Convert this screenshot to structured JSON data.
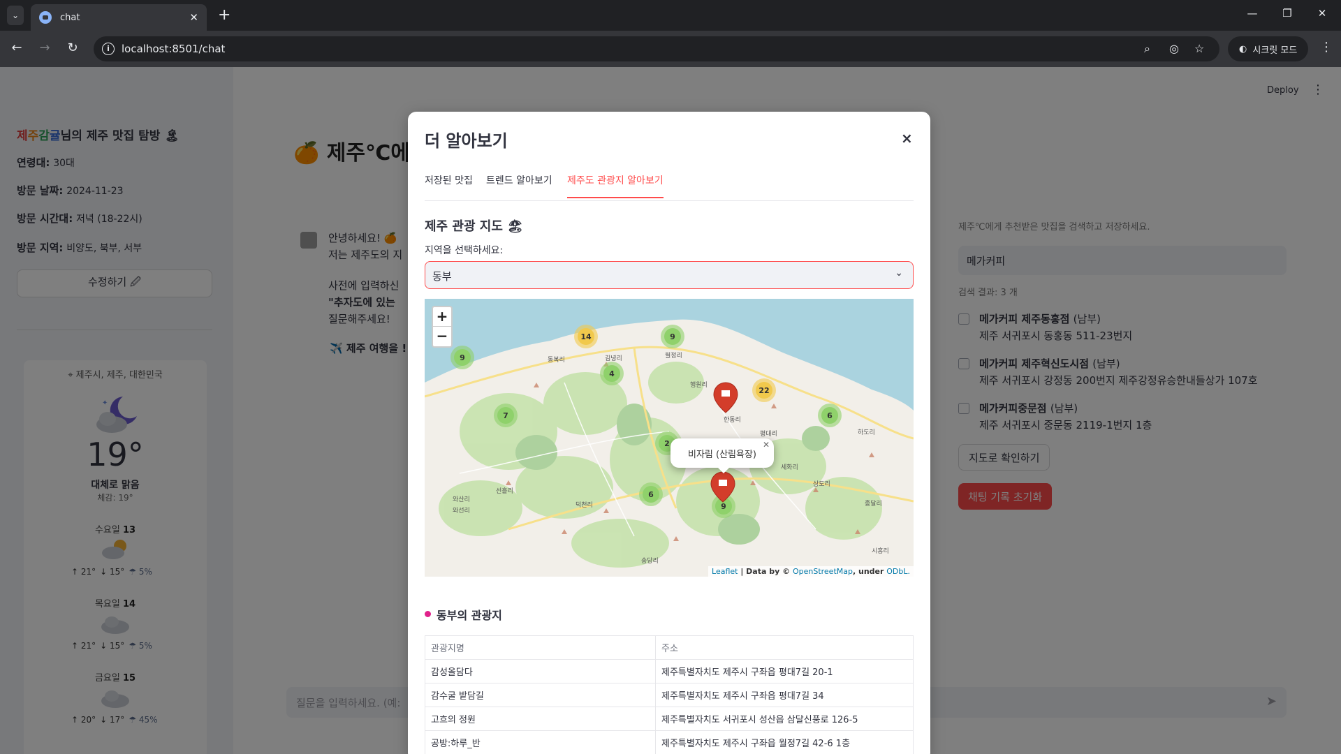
{
  "browser": {
    "tab_title": "chat",
    "url": "localhost:8501/chat",
    "incognito_label": "시크릿 모드"
  },
  "sidebar": {
    "title_parts": [
      "제",
      "주",
      "감",
      "귤",
      "님의 제주 맛집 탐방 🏝"
    ],
    "info": [
      {
        "label": "연령대:",
        "value": "30대"
      },
      {
        "label": "방문 날짜:",
        "value": "2024-11-23"
      },
      {
        "label": "방문 시간대:",
        "value": "저녁 (18-22시)"
      },
      {
        "label": "방문 지역:",
        "value": "비양도, 북부, 서부"
      }
    ],
    "edit_button": "수정하기 🖉"
  },
  "weather": {
    "location": "제주시, 제주, 대한민국",
    "temp": "19°",
    "condition": "대체로 맑음",
    "feels_like": "체감: 19°",
    "days": [
      {
        "name": "수요일",
        "date": "13",
        "high": "↑ 21°",
        "low": "↓ 15°",
        "rain": "5%"
      },
      {
        "name": "목요일",
        "date": "14",
        "high": "↑ 21°",
        "low": "↓ 15°",
        "rain": "5%"
      },
      {
        "name": "금요일",
        "date": "15",
        "high": "↑ 20°",
        "low": "↓ 17°",
        "rain": "45%"
      }
    ]
  },
  "main": {
    "title": "🍊 제주℃에게",
    "chat_lines": [
      "안녕하세요! 🍊",
      "저는 제주도의 지",
      "사전에 입력하신",
      "\"추자도에 있는",
      "질문해주세요!",
      "✈️ 제주 여행을 !"
    ],
    "input_placeholder": "질문을 입력하세요. (예:",
    "deploy": "Deploy"
  },
  "right_panel": {
    "note": "제주℃에게 추천받은 맛집을 검색하고 저장하세요.",
    "search_value": "메가커피",
    "result_count": "검색 결과: 3 개",
    "results": [
      {
        "name": "메가커피 제주동홍점",
        "region": "(남부)",
        "address": "제주 서귀포시 동홍동 511-23번지"
      },
      {
        "name": "메가커피 제주혁신도시점",
        "region": "(남부)",
        "address": "제주 서귀포시 강정동 200번지 제주강정유승한내들상가 107호"
      },
      {
        "name": "메가커피중문점",
        "region": "(남부)",
        "address": "제주 서귀포시 중문동 2119-1번지 1층"
      }
    ],
    "map_button": "지도로 확인하기",
    "reset_button": "채팅 기록 초기화"
  },
  "modal": {
    "title": "더 알아보기",
    "close": "×",
    "tabs": [
      "저장된 맛집",
      "트렌드 알아보기",
      "제주도 관광지 알아보기"
    ],
    "active_tab": 2,
    "section_title": "제주 관광 지도 🏖",
    "select_label": "지역을 선택하세요:",
    "select_value": "동부",
    "map": {
      "zoom_in": "+",
      "zoom_out": "−",
      "popup": "비자림 (산림욕장)",
      "attribution_prefix": "Leaflet",
      "attribution_mid": " | Data by © ",
      "attribution_osm": "OpenStreetMap",
      "attribution_under": ", under ",
      "attribution_odbl": "ODbL.",
      "clusters": [
        {
          "count": "14",
          "color": "#f1c94c"
        },
        {
          "count": "9",
          "color": "#8fd16b"
        },
        {
          "count": "9",
          "color": "#8fd16b"
        },
        {
          "count": "4",
          "color": "#8fd16b"
        },
        {
          "count": "22",
          "color": "#f1c94c"
        },
        {
          "count": "7",
          "color": "#8fd16b"
        },
        {
          "count": "6",
          "color": "#8fd16b"
        },
        {
          "count": "2",
          "color": "#8fd16b"
        },
        {
          "count": "6",
          "color": "#8fd16b"
        },
        {
          "count": "9",
          "color": "#8fd16b"
        }
      ],
      "place_labels": [
        "동복리",
        "김녕리",
        "월정리",
        "행원리",
        "한동리",
        "평대리",
        "하도리",
        "세화리",
        "상도리",
        "선흘리",
        "덕천리",
        "와산리",
        "와선리",
        "종달리",
        "시흥리",
        "송당리"
      ]
    },
    "list_title": "동부의 관광지",
    "table": {
      "headers": [
        "관광지명",
        "주소"
      ],
      "rows": [
        [
          "감성올담다",
          "제주특별자치도 제주시 구좌읍 평대7길 20-1"
        ],
        [
          "감수굴 밭담길",
          "제주특별자치도 제주시 구좌읍 평대7길 34"
        ],
        [
          "고흐의 정원",
          "제주특별자치도 서귀포시 성산읍 삼달신풍로 126-5"
        ],
        [
          "공방:하루_반",
          "제주특별자치도 제주시 구좌읍 월정7길 42-6 1층"
        ]
      ]
    }
  }
}
